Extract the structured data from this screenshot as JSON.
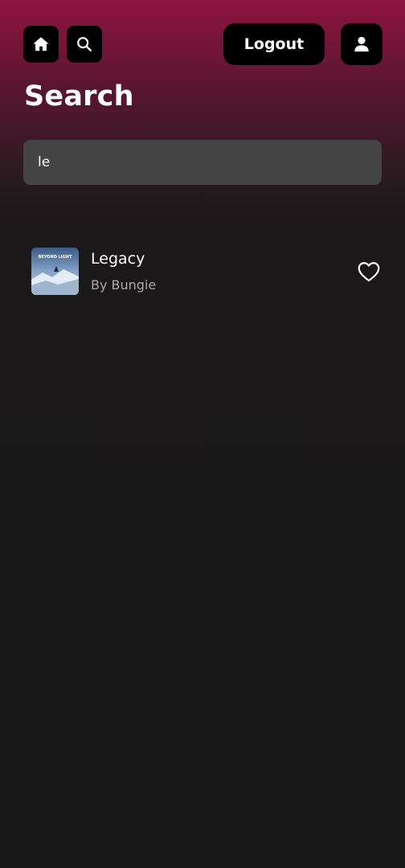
{
  "header": {
    "logout_label": "Logout",
    "icons": {
      "home": "home-icon",
      "search": "search-icon",
      "profile": "user-icon"
    }
  },
  "page": {
    "title": "Search"
  },
  "search": {
    "value": "le"
  },
  "results": [
    {
      "title": "Legacy",
      "artist": "By Bungie",
      "cover_text": "BEYOND LIGHT",
      "favorite": false
    }
  ],
  "colors": {
    "accent_top": "#8e1440",
    "background": "#181818",
    "search_field": "#444444",
    "button_bg": "#000000",
    "secondary_text": "#a9a9a9"
  }
}
